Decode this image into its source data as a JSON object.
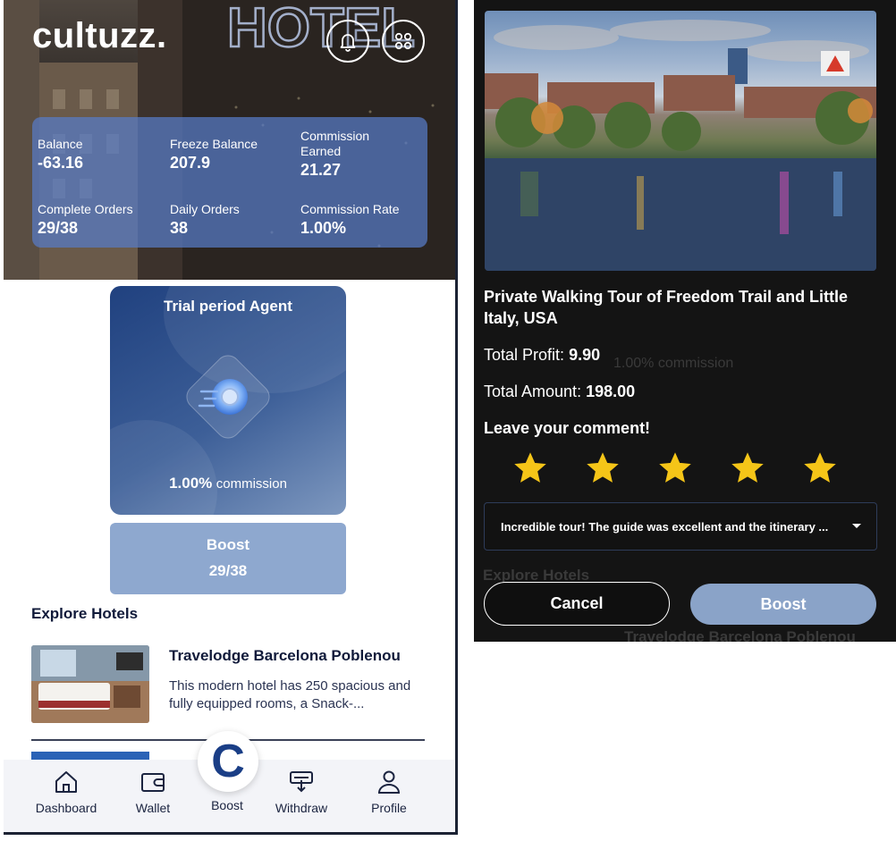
{
  "left": {
    "app_logo": "cultuzz.",
    "stats": {
      "balance_label": "Balance",
      "balance_value": "-63.16",
      "freeze_label": "Freeze Balance",
      "freeze_value": "207.9",
      "commission_earned_label_1": "Commission",
      "commission_earned_label_2": "Earned",
      "commission_earned_value": "21.27",
      "complete_orders_label": "Complete Orders",
      "complete_orders_value": "29/38",
      "daily_orders_label": "Daily Orders",
      "daily_orders_value": "38",
      "commission_rate_label": "Commission Rate",
      "commission_rate_value": "1.00%"
    },
    "trial": {
      "title": "Trial period Agent",
      "commission_value": "1.00%",
      "commission_label": "commission"
    },
    "boost_card": {
      "label": "Boost",
      "progress": "29/38"
    },
    "explore_heading": "Explore Hotels",
    "hotel": {
      "name": "Travelodge Barcelona Poblenou",
      "description": "This modern hotel has 250 spacious and fully equipped rooms, a Snack-..."
    },
    "nav": {
      "fab_letter": "C",
      "items": [
        {
          "label": "Dashboard",
          "icon": "home-icon"
        },
        {
          "label": "Wallet",
          "icon": "wallet-icon"
        },
        {
          "label": "Boost",
          "icon": "boost-icon"
        },
        {
          "label": "Withdraw",
          "icon": "withdraw-icon"
        },
        {
          "label": "Profile",
          "icon": "profile-icon"
        }
      ]
    }
  },
  "right": {
    "tour_title": "Private Walking Tour of Freedom Trail and Little Italy, USA",
    "total_profit_label": "Total Profit:",
    "total_profit_value": "9.90",
    "total_amount_label": "Total Amount:",
    "total_amount_value": "198.00",
    "comment_heading": "Leave your comment!",
    "rating": {
      "value": 5,
      "max": 5
    },
    "comment_selected": "Incredible tour! The guide was excellent and the itinerary ...",
    "cancel_label": "Cancel",
    "boost_label": "Boost",
    "background_ghost": {
      "commission": "1.00% commission",
      "explore": "Explore Hotels",
      "hotel": "Travelodge Barcelona Poblenou"
    }
  },
  "colors": {
    "accent_blue": "#1a3e86",
    "boost_blue": "#8ea8cf",
    "star_gold": "#f5c518",
    "modal_bg": "#141414"
  }
}
